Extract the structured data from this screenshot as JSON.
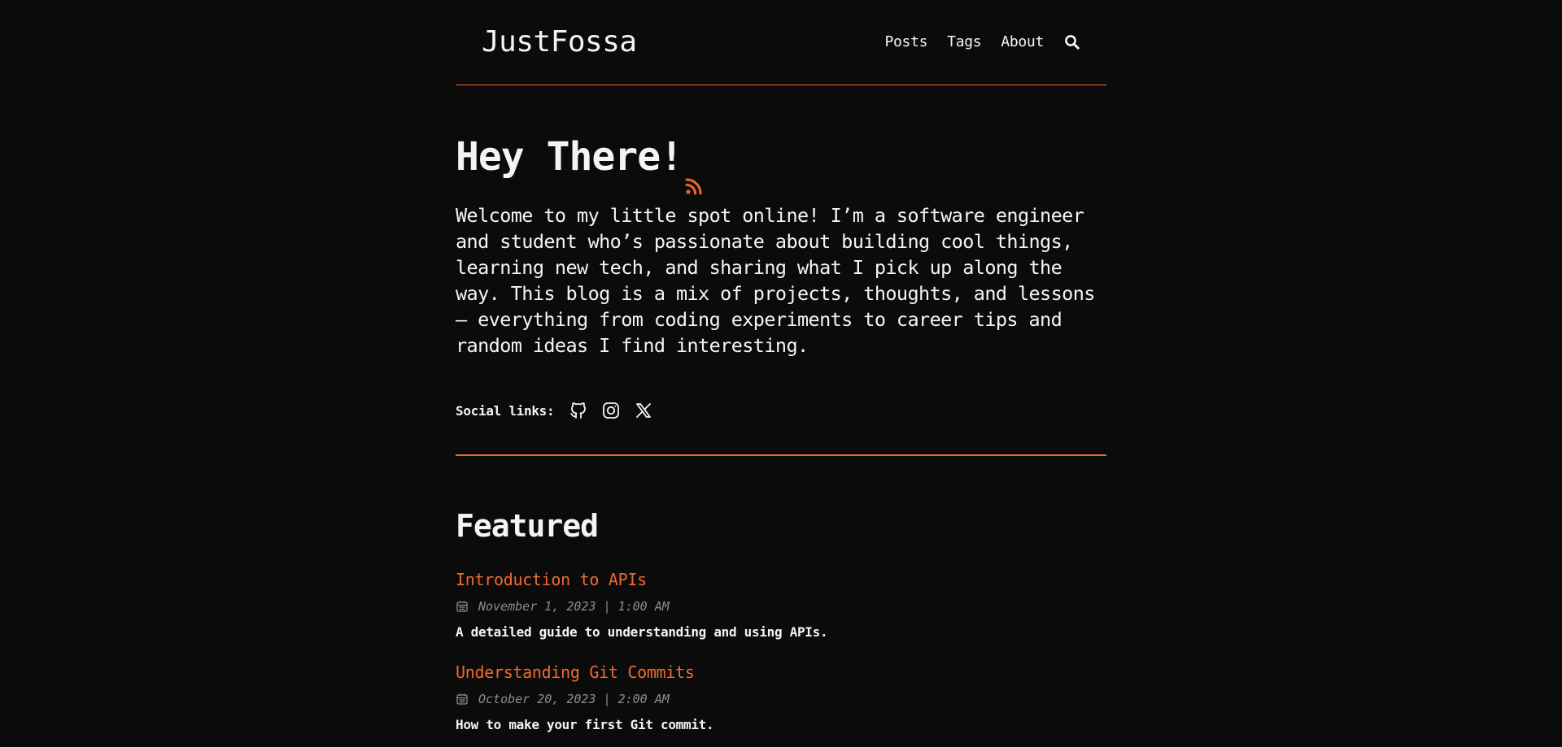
{
  "colors": {
    "background": "#0b0b0b",
    "accent": "#f0692b",
    "text": "#f4f4f4",
    "muted": "#8a8d96"
  },
  "header": {
    "site_name": "JustFossa",
    "nav": [
      "Posts",
      "Tags",
      "About"
    ],
    "search_icon": "search-icon"
  },
  "hero": {
    "title": "Hey There!",
    "rss_icon": "rss-icon",
    "intro": "Welcome to my little spot online! I’m a software engineer and student who’s passionate about building cool things, learning new tech, and sharing what I pick up along the way. This blog is a mix of projects, thoughts, and lessons — everything from coding experiments to career tips and random ideas I find interesting.",
    "social_label": "Social links:",
    "social_icons": [
      "github-icon",
      "instagram-icon",
      "x-icon"
    ]
  },
  "featured": {
    "heading": "Featured",
    "posts": [
      {
        "title": "Introduction to APIs",
        "date": "November 1, 2023 | 1:00 AM",
        "description": "A detailed guide to understanding and using APIs."
      },
      {
        "title": "Understanding Git Commits",
        "date": "October 20, 2023 | 2:00 AM",
        "description": "How to make your first Git commit."
      }
    ]
  }
}
